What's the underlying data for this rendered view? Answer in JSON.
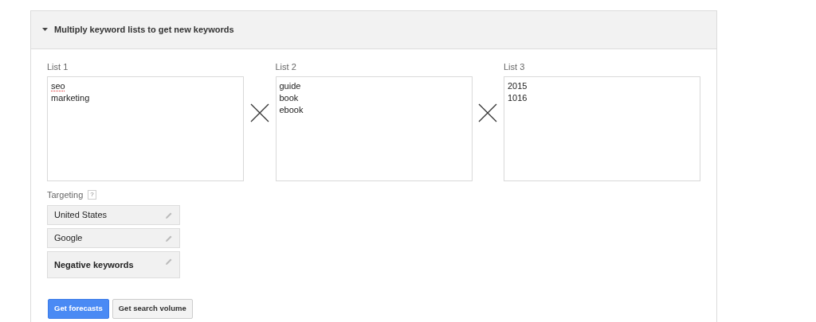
{
  "panel": {
    "title": "Multiply keyword lists to get new keywords",
    "expanded": true
  },
  "lists": [
    {
      "label": "List 1",
      "lines": [
        {
          "text": "seo",
          "misspelled": true
        },
        {
          "text": "marketing",
          "misspelled": false
        }
      ]
    },
    {
      "label": "List 2",
      "lines": [
        {
          "text": "guide",
          "misspelled": false
        },
        {
          "text": "book",
          "misspelled": false
        },
        {
          "text": "ebook",
          "misspelled": false
        }
      ]
    },
    {
      "label": "List 3",
      "lines": [
        {
          "text": "2015",
          "misspelled": false
        },
        {
          "text": "1016",
          "misspelled": false
        }
      ]
    }
  ],
  "targeting": {
    "label": "Targeting",
    "help": "?",
    "items": [
      {
        "text": "United States",
        "bold": false
      },
      {
        "text": "Google",
        "bold": false
      },
      {
        "text": "Negative keywords",
        "bold": true
      }
    ]
  },
  "buttons": [
    {
      "label": "Get forecasts",
      "kind": "primary"
    },
    {
      "label": "Get search volume",
      "kind": "secondary"
    }
  ]
}
